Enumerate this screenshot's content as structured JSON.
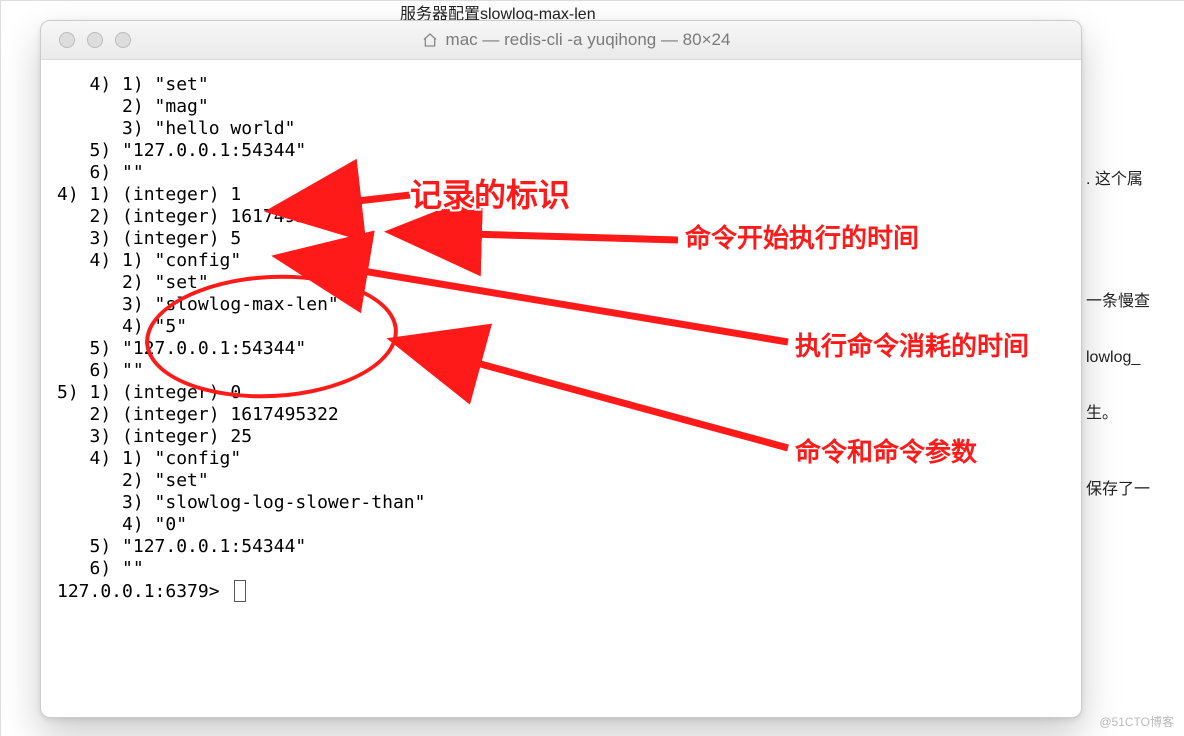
{
  "background": {
    "header": "服务器配置slowlog-max-len",
    "side_lines": [
      ". 这个属",
      "一条慢查",
      "lowlog_",
      "生。",
      "保存了一"
    ],
    "watermark": "@51CTO博客"
  },
  "window": {
    "title": "mac — redis-cli -a yuqihong — 80×24",
    "icon": "home-icon",
    "content": "   4) 1) \"set\"\n      2) \"mag\"\n      3) \"hello world\"\n   5) \"127.0.0.1:54344\"\n   6) \"\"\n4) 1) (integer) 1\n   2) (integer) 1617495335\n   3) (integer) 5\n   4) 1) \"config\"\n      2) \"set\"\n      3) \"slowlog-max-len\"\n      4) \"5\"\n   5) \"127.0.0.1:54344\"\n   6) \"\"\n5) 1) (integer) 0\n   2) (integer) 1617495322\n   3) (integer) 25\n   4) 1) \"config\"\n      2) \"set\"\n      3) \"slowlog-log-slower-than\"\n      4) \"0\"\n   5) \"127.0.0.1:54344\"\n   6) \"\"\n",
    "prompt": "127.0.0.1:6379> "
  },
  "annotations": {
    "a1": "记录的标识",
    "a2": "命令开始执行的时间",
    "a3": "执行命令消耗的时间",
    "a4": "命令和命令参数"
  }
}
